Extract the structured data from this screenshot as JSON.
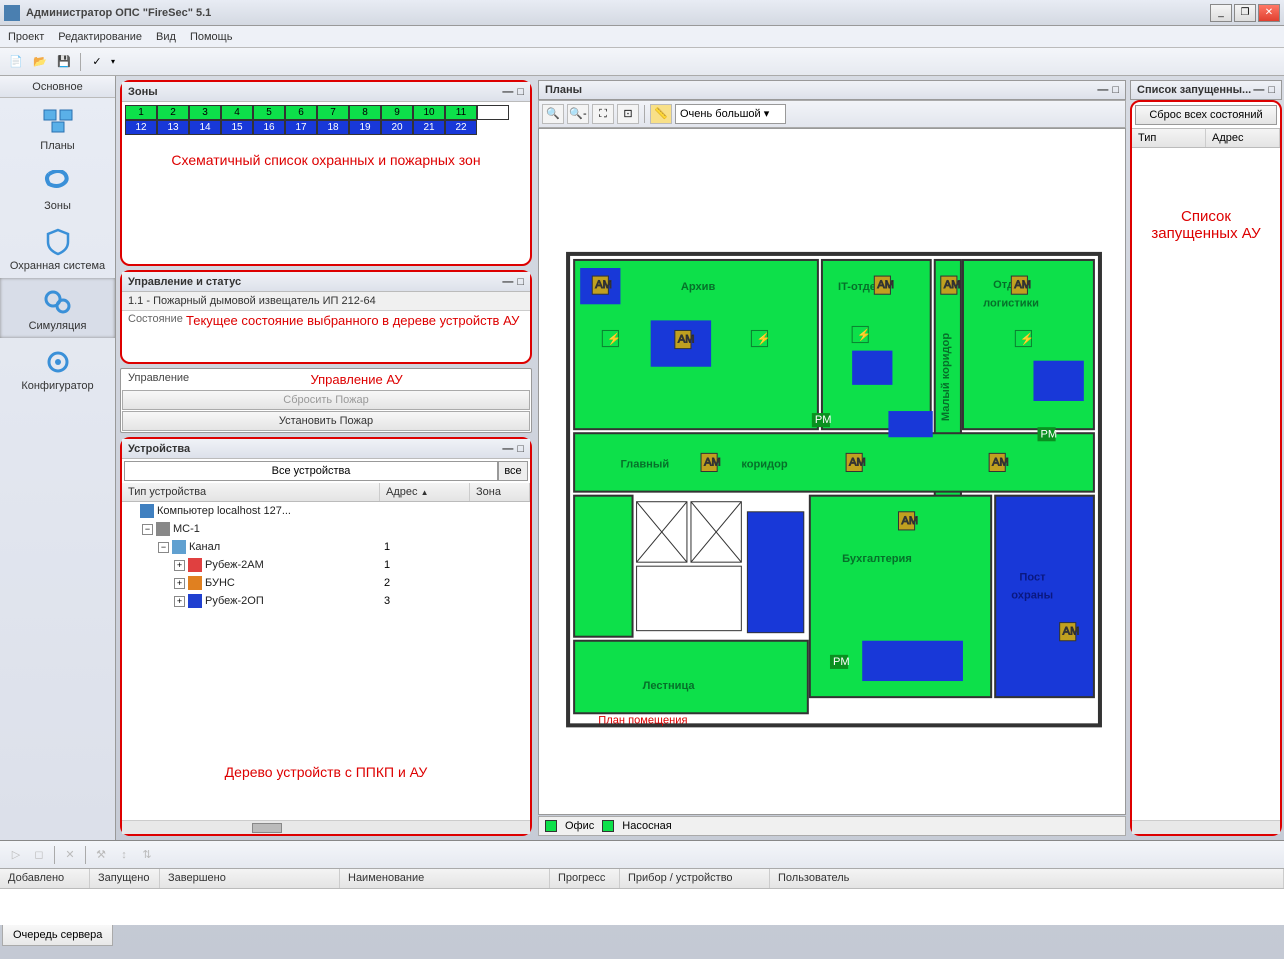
{
  "window": {
    "title": "Администратор ОПС \"FireSec\" 5.1"
  },
  "menu": {
    "project": "Проект",
    "edit": "Редактирование",
    "view": "Вид",
    "help": "Помощь"
  },
  "sidebar": {
    "header": "Основное",
    "items": [
      {
        "label": "Планы"
      },
      {
        "label": "Зоны"
      },
      {
        "label": "Охранная система"
      },
      {
        "label": "Симуляция"
      },
      {
        "label": "Конфигуратор"
      }
    ]
  },
  "panels": {
    "zones": {
      "title": "Зоны"
    },
    "control": {
      "title": "Управление и статус"
    },
    "devices": {
      "title": "Устройства"
    },
    "plans": {
      "title": "Планы"
    },
    "launched": {
      "title": "Список запущенны..."
    }
  },
  "zones": {
    "row1": [
      "1",
      "2",
      "3",
      "4",
      "5",
      "6",
      "7",
      "8",
      "9",
      "10",
      "11"
    ],
    "row2": [
      "12",
      "13",
      "14",
      "15",
      "16",
      "17",
      "18",
      "19",
      "20",
      "21",
      "22"
    ],
    "annotation": "Схематичный список охранных и пожарных зон"
  },
  "control": {
    "device_line": "1.1 - Пожарный дымовой извещатель ИП 212-64",
    "status_label": "Состояние",
    "status_annot": "Текущее состояние выбранного в дереве устройств АУ",
    "manage_label": "Управление",
    "manage_annot": "Управление АУ",
    "btn_reset": "Сбросить Пожар",
    "btn_set": "Установить Пожар"
  },
  "devices": {
    "combo": "Все устройства",
    "combo_btn": "все",
    "col_type": "Тип устройства",
    "col_addr": "Адрес",
    "col_zone": "Зона",
    "tree": [
      {
        "indent": 0,
        "exp": "",
        "icon": "pc",
        "label": "Компьютер localhost 127...",
        "addr": "",
        "zone": ""
      },
      {
        "indent": 1,
        "exp": "−",
        "icon": "board",
        "label": "МС-1",
        "addr": "",
        "zone": ""
      },
      {
        "indent": 2,
        "exp": "−",
        "icon": "channel",
        "label": "Канал",
        "addr": "1",
        "zone": ""
      },
      {
        "indent": 3,
        "exp": "+",
        "icon": "red",
        "label": "Рубеж-2АМ",
        "addr": "1",
        "zone": ""
      },
      {
        "indent": 3,
        "exp": "+",
        "icon": "orange",
        "label": "БУНС",
        "addr": "2",
        "zone": ""
      },
      {
        "indent": 3,
        "exp": "+",
        "icon": "blue",
        "label": "Рубеж-2ОП",
        "addr": "3",
        "zone": ""
      }
    ],
    "annotation": "Дерево устройств с ППКП и АУ"
  },
  "plans": {
    "zoom_combo": "Очень большой",
    "rooms": {
      "archive": "Архив",
      "it": "IT-отдел",
      "logistics": "Отдел логистики",
      "corridor_small": "Малый коридор",
      "corridor_main": "Главный",
      "corridor_main2": "коридор",
      "accounting": "Бухгалтерия",
      "security": "Пост охраны",
      "stairs": "Лестница"
    },
    "annotation": "План помещения",
    "tab_office": "Офис",
    "tab_pump": "Насосная"
  },
  "launched": {
    "reset_all": "Сброс всех состояний",
    "col_type": "Тип",
    "col_addr": "Адрес",
    "annotation": "Список запущенных АУ"
  },
  "status": {
    "added": "Добавлено",
    "started": "Запущено",
    "finished": "Завершено",
    "name": "Наименование",
    "progress": "Прогресс",
    "device": "Прибор / устройство",
    "user": "Пользователь"
  },
  "footer": {
    "queue": "Очередь сервера"
  }
}
